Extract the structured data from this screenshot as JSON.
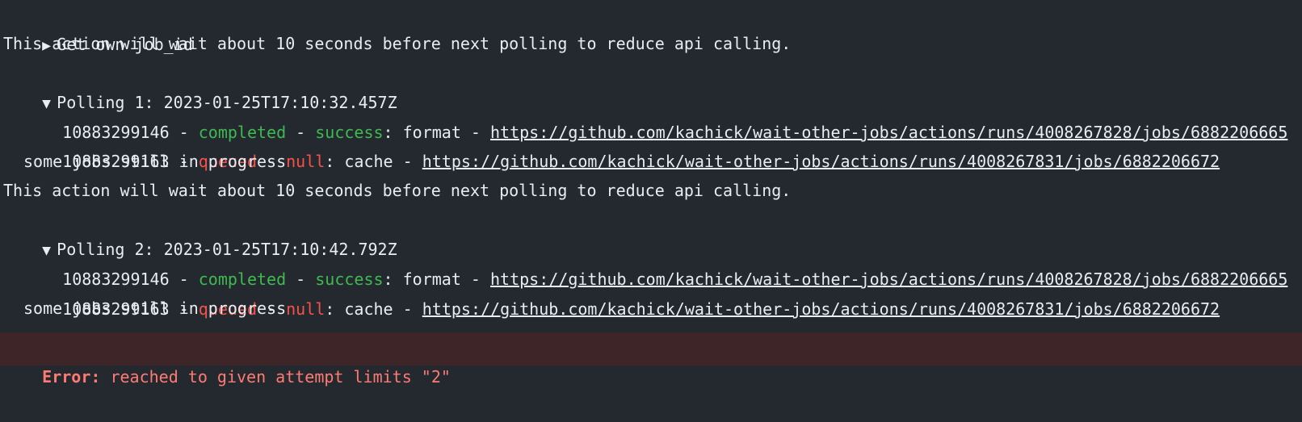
{
  "log": {
    "get_own": {
      "toggle": "▶",
      "label": "Get own job_id"
    },
    "wait_msg_1": "This action will wait about 10 seconds before next polling to reduce api calling.",
    "polling_1": {
      "toggle": "▼",
      "label": "Polling 1: 2023-01-25T17:10:32.457Z",
      "jobs": [
        {
          "id": "10883299146",
          "status": "completed",
          "conclusion": "success",
          "name": "format",
          "url": "https://github.com/kachick/wait-other-jobs/actions/runs/4008267828/jobs/6882206665"
        },
        {
          "id": "10883299163",
          "status": "queued",
          "conclusion": "null",
          "name": "cache",
          "url": "https://github.com/kachick/wait-other-jobs/actions/runs/4008267831/jobs/6882206672"
        }
      ],
      "footer": "some jobs still in progress"
    },
    "wait_msg_2": "This action will wait about 10 seconds before next polling to reduce api calling.",
    "polling_2": {
      "toggle": "▼",
      "label": "Polling 2: 2023-01-25T17:10:42.792Z",
      "jobs": [
        {
          "id": "10883299146",
          "status": "completed",
          "conclusion": "success",
          "name": "format",
          "url": "https://github.com/kachick/wait-other-jobs/actions/runs/4008267828/jobs/6882206665"
        },
        {
          "id": "10883299163",
          "status": "queued",
          "conclusion": "null",
          "name": "cache",
          "url": "https://github.com/kachick/wait-other-jobs/actions/runs/4008267831/jobs/6882206672"
        }
      ],
      "footer": "some jobs still in progress"
    },
    "error": {
      "label": "Error:",
      "message": " reached to given attempt limits \"2\""
    },
    "separators": {
      "dash": " - ",
      "colon": ": "
    }
  },
  "colors": {
    "background": "#24292f",
    "text": "#e6edf3",
    "success": "#3fb950",
    "failure": "#f85149",
    "error_bg": "#3d2528",
    "error_text": "#ff7b72"
  }
}
